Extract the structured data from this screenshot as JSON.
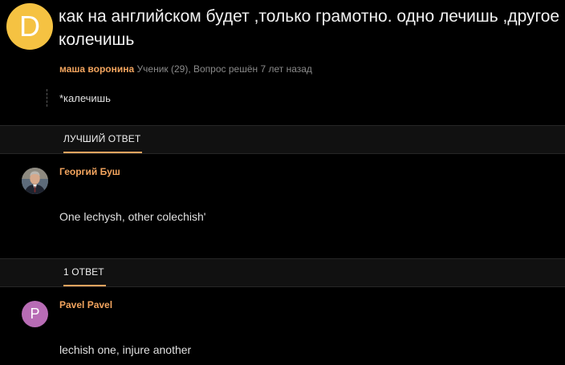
{
  "question": {
    "avatar_letter": "D",
    "title": "как на английском будет ,только грамотно. одно лечишь ,другое колечишь",
    "author": "маша воронина",
    "meta": "Ученик (29), Вопрос решён 7 лет назад",
    "addition": "*калечишь"
  },
  "best_answer_section": {
    "tab_label": "ЛУЧШИЙ ОТВЕТ"
  },
  "best_answer": {
    "author": "Георгий Буш",
    "text": "One lechysh, other colechish'"
  },
  "answers_section": {
    "tab_label": "1 ОТВЕТ"
  },
  "answers": [
    {
      "avatar_letter": "P",
      "author": "Pavel Pavel",
      "text": "lechish one, injure another"
    }
  ],
  "colors": {
    "background": "#000000",
    "accent": "#f2a45e",
    "question_avatar": "#f5c242",
    "answer_avatar": "#b86cb5"
  }
}
